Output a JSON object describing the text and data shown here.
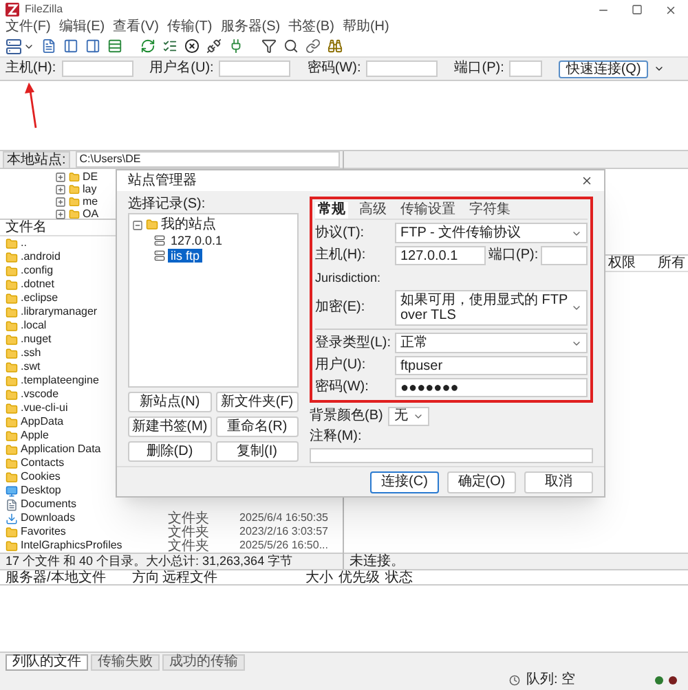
{
  "window": {
    "title": "FileZilla"
  },
  "menu": [
    "文件(F)",
    "编辑(E)",
    "查看(V)",
    "传输(T)",
    "服务器(S)",
    "书签(B)",
    "帮助(H)"
  ],
  "quickconnect": {
    "fields": [
      {
        "label": "主机(H):"
      },
      {
        "label": "用户名(U):"
      },
      {
        "label": "密码(W):"
      },
      {
        "label": "端口(P):"
      }
    ],
    "button": "快速连接(Q)"
  },
  "local": {
    "path_label": "本地站点:",
    "path": "C:\\Users\\DE",
    "tree": [
      {
        "name": "DE",
        "expanded": false
      },
      {
        "name": "lay",
        "expanded": false
      },
      {
        "name": "me",
        "expanded": false
      },
      {
        "name": "OA",
        "expanded": false
      }
    ],
    "columns": [
      "文件名"
    ],
    "rows": [
      {
        "name": "..",
        "kind": "folder"
      },
      {
        "name": ".android",
        "kind": "folder"
      },
      {
        "name": ".config",
        "kind": "folder"
      },
      {
        "name": ".dotnet",
        "kind": "folder"
      },
      {
        "name": ".eclipse",
        "kind": "folder"
      },
      {
        "name": ".librarymanager",
        "kind": "folder"
      },
      {
        "name": ".local",
        "kind": "folder"
      },
      {
        "name": ".nuget",
        "kind": "folder"
      },
      {
        "name": ".ssh",
        "kind": "folder"
      },
      {
        "name": ".swt",
        "kind": "folder"
      },
      {
        "name": ".templateengine",
        "kind": "folder"
      },
      {
        "name": ".vscode",
        "kind": "folder"
      },
      {
        "name": ".vue-cli-ui",
        "kind": "folder"
      },
      {
        "name": "AppData",
        "kind": "folder"
      },
      {
        "name": "Apple",
        "kind": "folder"
      },
      {
        "name": "Application Data",
        "kind": "folder"
      },
      {
        "name": "Contacts",
        "kind": "folder"
      },
      {
        "name": "Cookies",
        "kind": "folder"
      },
      {
        "name": "Desktop",
        "kind": "desktop"
      },
      {
        "name": "Documents",
        "kind": "documents"
      },
      {
        "name": "Downloads",
        "kind": "downloads",
        "type": "文件夹",
        "modified": "2025/6/4 16:50:35"
      },
      {
        "name": "Favorites",
        "kind": "folder",
        "type": "文件夹",
        "modified": "2023/2/16 3:03:57"
      },
      {
        "name": "IntelGraphicsProfiles",
        "kind": "folder",
        "type": "文件夹",
        "modified": "2025/5/26 16:50..."
      }
    ],
    "status": "17 个文件 和 40 个目录。大小总计: 31,263,364 字节"
  },
  "remote": {
    "columns": [
      "权限",
      "所有"
    ],
    "status": "未连接。"
  },
  "queue": {
    "columns": [
      "服务器/本地文件",
      "方向",
      "远程文件",
      "大小",
      "优先级",
      "状态"
    ],
    "tabs": [
      {
        "label": "列队的文件",
        "selected": true
      },
      {
        "label": "传输失败",
        "selected": false
      },
      {
        "label": "成功的传输",
        "selected": false
      }
    ],
    "status": "队列: 空"
  },
  "site_manager": {
    "title": "站点管理器",
    "tree_label": "选择记录(S):",
    "tree": [
      {
        "name": "我的站点",
        "expanded": true,
        "children": [
          {
            "name": "127.0.0.1",
            "selected": false
          },
          {
            "name": "iis ftp",
            "selected": true
          }
        ]
      }
    ],
    "buttons": [
      "新站点(N)",
      "新文件夹(F)",
      "新建书签(M)",
      "重命名(R)",
      "删除(D)",
      "复制(I)"
    ],
    "tabs": [
      {
        "label": "常规",
        "selected": true
      },
      {
        "label": "高级",
        "selected": false
      },
      {
        "label": "传输设置",
        "selected": false
      },
      {
        "label": "字符集",
        "selected": false
      }
    ],
    "fields": [
      {
        "kind": "select",
        "label": "协议(T):",
        "value": "FTP - 文件传输协议"
      },
      {
        "kind": "host",
        "label": "主机(H):",
        "value": "127.0.0.1",
        "port_label": "端口(P):"
      },
      {
        "kind": "note",
        "label": "Jurisdiction:"
      },
      {
        "kind": "select",
        "label": "加密(E):",
        "value": "如果可用，使用显式的 FTP over TLS"
      },
      {
        "kind": "select",
        "label": "登录类型(L):",
        "value": "正常",
        "divider_above": true
      },
      {
        "kind": "text",
        "label": "用户(U):",
        "value": "ftpuser"
      },
      {
        "kind": "text",
        "label": "密码(W):",
        "value": "●●●●●●●"
      }
    ],
    "background_color": {
      "label": "背景颜色(B)",
      "value": "无"
    },
    "comment_label": "注释(M):",
    "footer_buttons": [
      {
        "label": "连接(C)",
        "default": true
      },
      {
        "label": "确定(O)",
        "default": false
      },
      {
        "label": "取消",
        "default": false
      }
    ]
  }
}
